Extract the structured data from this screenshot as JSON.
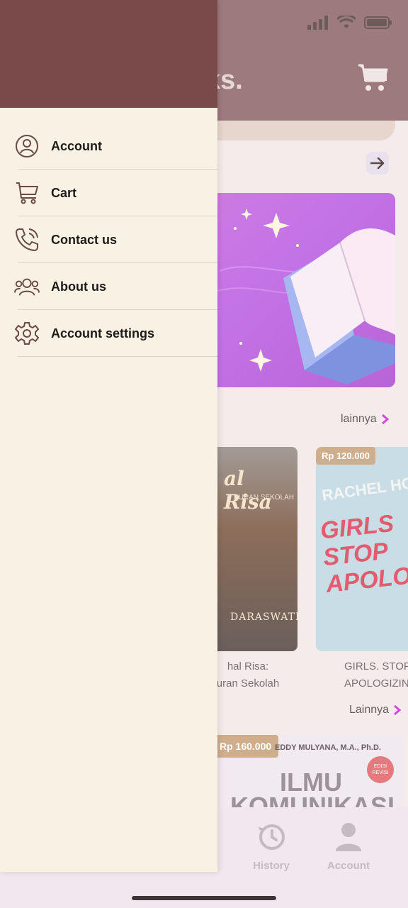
{
  "app": {
    "title_visible": "ks.",
    "colors": {
      "drawer_bg": "#f8f2e4",
      "drawer_header": "#7a4a4b",
      "accent_pink": "#d14bd8"
    }
  },
  "drawer": {
    "items": [
      {
        "label": "Account",
        "icon": "user-circle-icon"
      },
      {
        "label": "Cart",
        "icon": "cart-icon"
      },
      {
        "label": "Contact us",
        "icon": "phone-icon"
      },
      {
        "label": "About us",
        "icon": "users-icon"
      },
      {
        "label": "Account settings",
        "icon": "gear-icon"
      }
    ]
  },
  "main": {
    "section1_more": "lainnya",
    "section2_more": "Lainnya",
    "books": [
      {
        "price": "",
        "cover_title": "al Risa",
        "cover_subtitle": "BURAN SEKOLAH",
        "author": "DARASWATI",
        "title_line1": "hal Risa:",
        "title_line2": "uran Sekolah"
      },
      {
        "price": "Rp 120.000",
        "cover_title": "GIRLS STOP APOLOGIZ",
        "author": "RACHEL HOL",
        "title_line1": "GIRLS. STOP",
        "title_line2": "APOLOGIZIN"
      }
    ],
    "featured": {
      "price": "Rp 160.000",
      "author": "EDDY MULYANA, M.A., Ph.D.",
      "title_line1": "ILMU",
      "title_line2": "KOMUNIKASI",
      "badge": "EDISI REVISI"
    }
  },
  "bottom_nav": [
    {
      "label": "History",
      "icon": "history-icon"
    },
    {
      "label": "Account",
      "icon": "account-icon"
    }
  ]
}
